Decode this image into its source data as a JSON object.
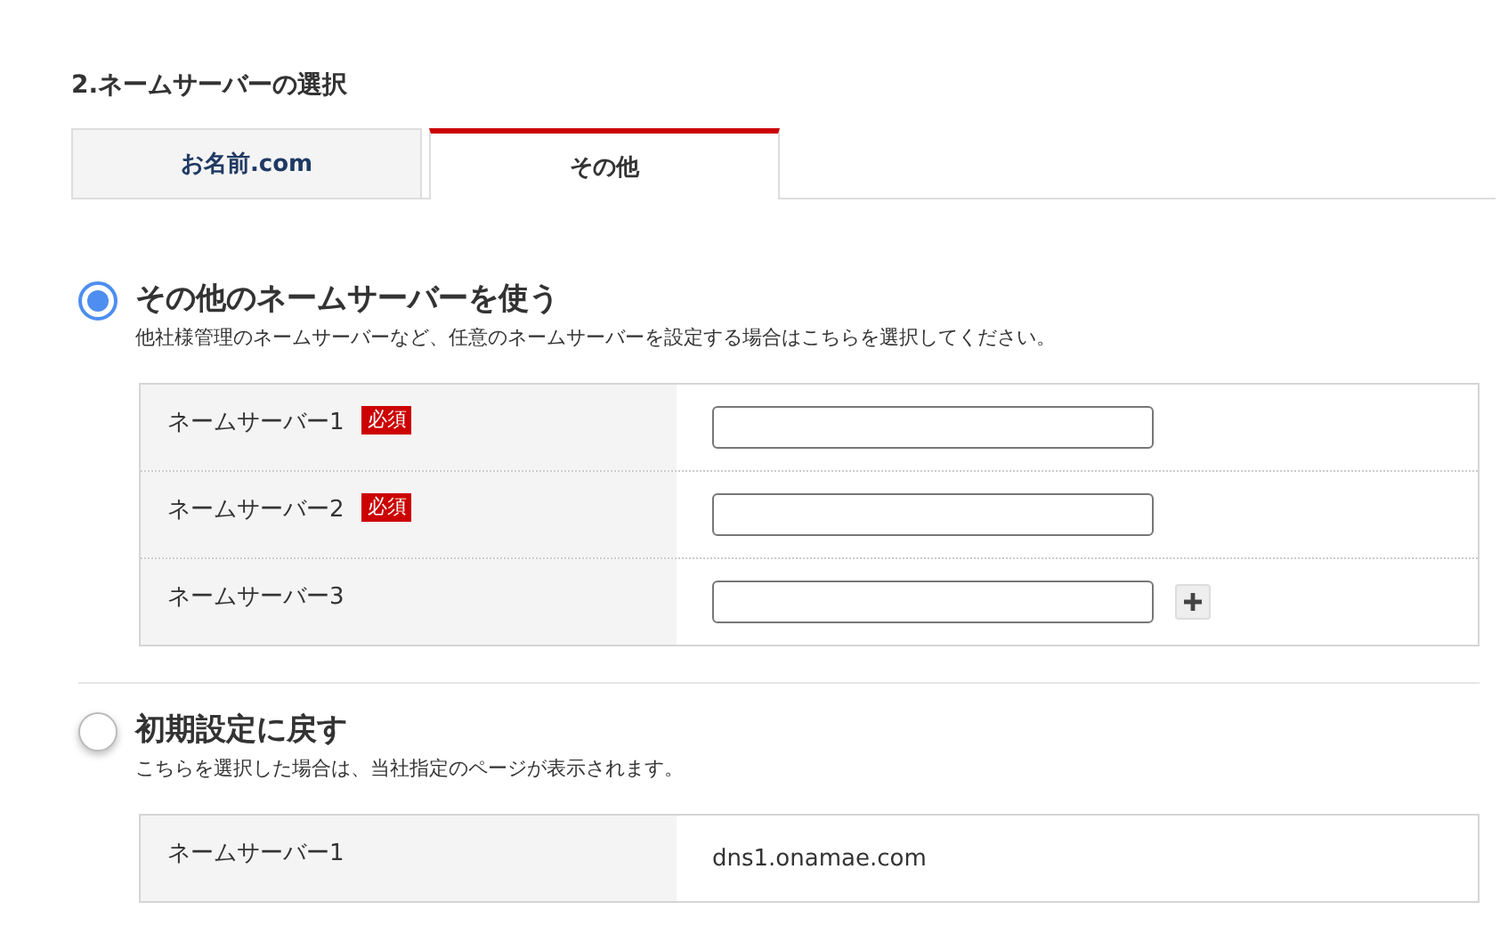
{
  "section_title": "2.ネームサーバーの選択",
  "tabs": [
    {
      "label": "お名前.com",
      "selected": false
    },
    {
      "label": "その他",
      "selected": true
    }
  ],
  "options": [
    {
      "title": "その他のネームサーバーを使う",
      "description": "他社様管理のネームサーバーなど、任意のネームサーバーを設定する場合はこちらを選択してください。",
      "selected": true,
      "rows": [
        {
          "label": "ネームサーバー1",
          "badge": "必須",
          "kind": "input",
          "add_button": false
        },
        {
          "label": "ネームサーバー2",
          "badge": "必須",
          "kind": "input",
          "add_button": false
        },
        {
          "label": "ネームサーバー3",
          "kind": "input",
          "add_button": true
        }
      ]
    },
    {
      "title": "初期設定に戻す",
      "description": "こちらを選択した場合は、当社指定のページが表示されます。",
      "selected": false,
      "rows": [
        {
          "label": "ネームサーバー1",
          "kind": "text",
          "value": "dns1.onamae.com"
        }
      ]
    }
  ]
}
